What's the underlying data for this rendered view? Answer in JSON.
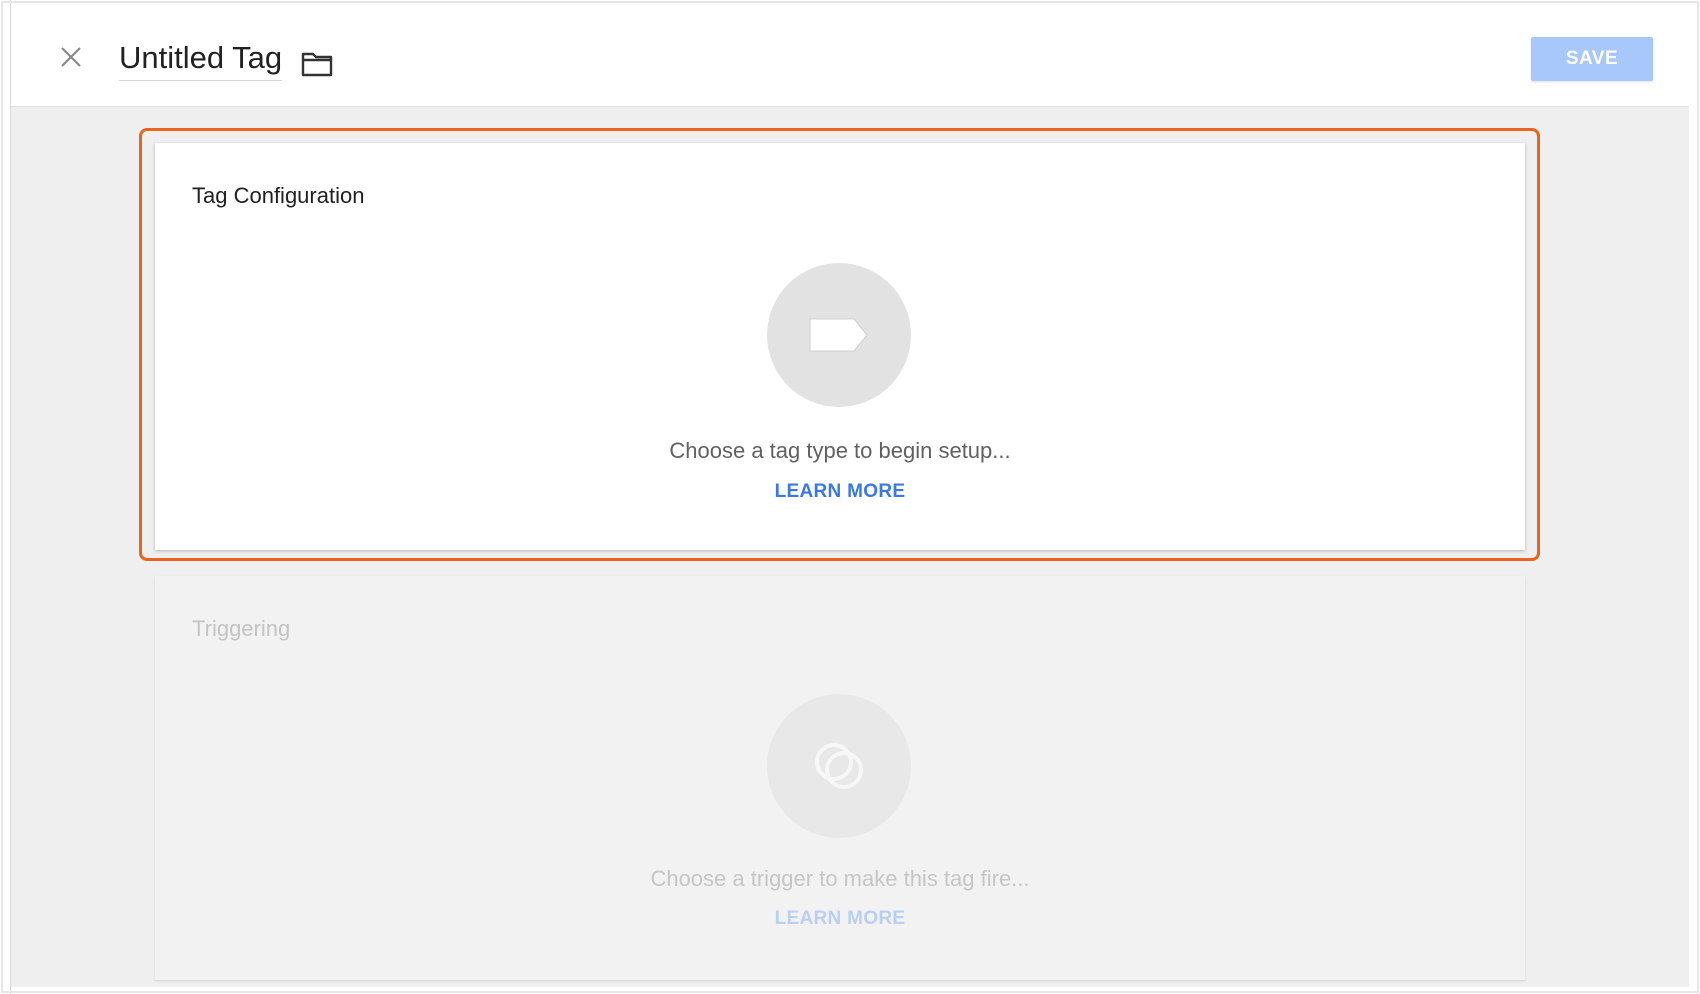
{
  "header": {
    "title": "Untitled Tag",
    "save_label": "SAVE",
    "close_icon": "close-icon",
    "folder_icon": "folder-icon"
  },
  "tag_configuration": {
    "title": "Tag Configuration",
    "prompt": "Choose a tag type to begin setup...",
    "learn_more": "LEARN MORE",
    "icon": "tag-icon"
  },
  "triggering": {
    "title": "Triggering",
    "prompt": "Choose a trigger to make this tag fire...",
    "learn_more": "LEARN MORE",
    "icon": "trigger-icon"
  },
  "colors": {
    "highlight": "#e8641f",
    "save_button": "#a8c7fa",
    "link": "#3b78e7",
    "background": "#efefef"
  }
}
